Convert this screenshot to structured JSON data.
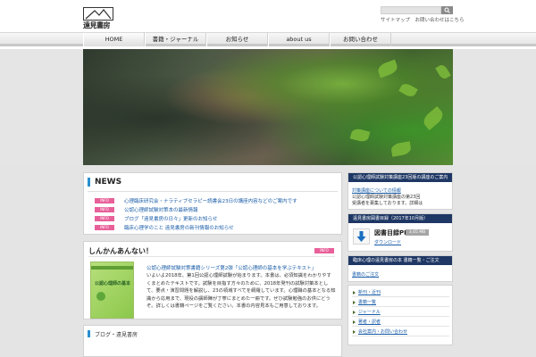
{
  "header": {
    "logo_top": "Tōmi Shobō",
    "logo_name": "遠見書房",
    "search": {
      "placeholder": ""
    },
    "links": "サイトマップ　お問い合わせはこちら"
  },
  "nav": {
    "items": [
      {
        "label": "HOME"
      },
      {
        "label": "書籍・ジャーナル"
      },
      {
        "label": "お知らせ"
      },
      {
        "label": "about us"
      },
      {
        "label": "お問い合わせ"
      }
    ]
  },
  "news": {
    "title": "NEWS",
    "items": [
      {
        "badge": "INFO",
        "text": "心理臨床研究会・ナラティブセラピー読書会23日の講座内容などのご案内です"
      },
      {
        "badge": "INFO",
        "text": "公認心理師試験対策本の最新情報"
      },
      {
        "badge": "INFO",
        "text": "ブログ「遠見書房の日々」更新のお知らせ"
      },
      {
        "badge": "INFO",
        "text": "臨床心理学のこと 遠見書房の新刊情報のお知らせ"
      }
    ]
  },
  "feature": {
    "title": "しんかんあんない！",
    "badge": "INFO",
    "book_title": "公認心理師の基本",
    "link": "公認心理師試験対策書籍シリーズ第2弾「公認心理師の基本を学ぶテキスト」",
    "body": "いよいよ2018年、第1回公認心理師試験が始まります。本書は、必須知識をわかりやすくまとめたテキストです。試験を目指す方々のために、2018年発刊の試験対策本として、要点・演習問題を解説し、23の領域すべてを網羅しています。心理職の基本となる知識から応用まで、現役の講師陣が丁寧にまとめた一冊です。ぜひ試験勉強のお供にどうぞ。詳しくは書籍ページをご覧ください。本書の内容見本もご用意しております。"
  },
  "sidebar": {
    "box1": {
      "header": "公認心理師試験対策講座23回版の講座のご案内",
      "link": "対策講座についての情報",
      "lines": [
        "公認心理師試験対策講座の第23回",
        "受講者を募集しております。詳細は"
      ]
    },
    "box2": {
      "header": "遠見書房図書目録（2017年10月版）",
      "title": "図書目録PDF",
      "size": "3.05 MB",
      "link": "ダウンロード"
    },
    "box3": {
      "header": "臨床心理の遠見書房の本 書籍一覧・ご注文",
      "link": "書籍のご注文"
    },
    "menu": [
      {
        "label": "新刊・近刊"
      },
      {
        "label": "書籍一覧"
      },
      {
        "label": "ジャーナル"
      },
      {
        "label": "著者・訳者"
      },
      {
        "label": "会社案内・お問い合わせ"
      }
    ]
  },
  "bottom": {
    "title": "ブログ・遠見書房"
  }
}
